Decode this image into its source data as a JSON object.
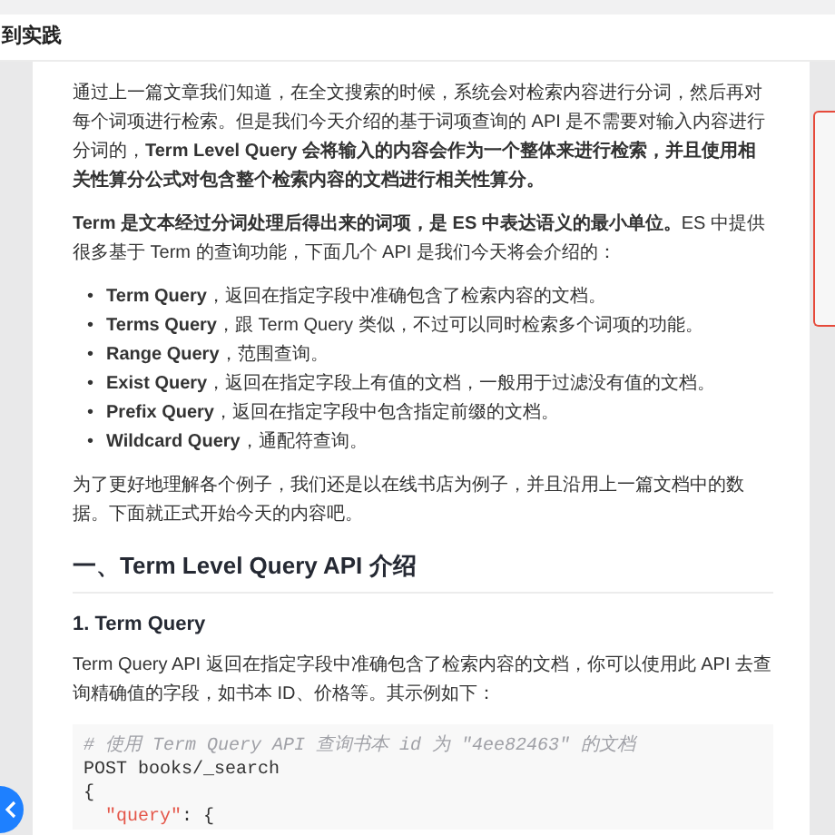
{
  "header": {
    "title": "到实践"
  },
  "paragraphs_top": [
    "通过上一篇文章我们知道，在全文搜索的时候，系统会对检索内容进行分词，然后再对每个词项进行检索。但是我们今天介绍的基于词项查询的 API 是不需要对输入内容进行分词的，**Term Level Query 会将输入的内容会作为一个整体来进行检索，并且使用相关性算分公式对包含整个检索内容的文档进行相关性算分。**",
    "**Term 是文本经过分词处理后得出来的词项，是 ES 中表达语义的最小单位。**ES 中提供很多基于 Term 的查询功能，下面几个 API 是我们今天将会介绍的："
  ],
  "query_list": [
    {
      "marker": "•",
      "text": "**Term Query**，返回在指定字段中准确包含了检索内容的文档。"
    },
    {
      "marker": "•",
      "text": "**Terms Query**，跟 Term Query 类似，不过可以同时检索多个词项的功能。"
    },
    {
      "marker": "•",
      "text": "**Range Query**，范围查询。"
    },
    {
      "marker": "•",
      "text": "**Exist Query**，返回在指定字段上有值的文档，一般用于过滤没有值的文档。"
    },
    {
      "marker": "•",
      "text": "**Prefix Query**，返回在指定字段中包含指定前缀的文档。"
    },
    {
      "marker": "•",
      "text": "**Wildcard Query**，通配符查询。"
    }
  ],
  "paragraph_examples": "为了更好地理解各个例子，我们还是以在线书店为例子，并且沿用上一篇文档中的数据。下面就正式开始今天的内容吧。",
  "section_heading": "一、Term Level Query API 介绍",
  "subsection_heading": "1. Term Query",
  "paragraph_term_query": "Term Query API 返回在指定字段中准确包含了检索内容的文档，你可以使用此 API 去查询精确值的字段，如书本 ID、价格等。其示例如下：",
  "code_lines": [
    {
      "indented": false,
      "tokens": [
        {
          "kind": "comment",
          "text": "# 使用 Term Query API 查询书本 id 为 \"4ee82463\" 的文档"
        }
      ]
    },
    {
      "indented": false,
      "tokens": [
        {
          "kind": "plain",
          "text": "POST books/_search"
        }
      ]
    },
    {
      "indented": false,
      "tokens": [
        {
          "kind": "plain",
          "text": "{"
        }
      ]
    },
    {
      "indented": true,
      "tokens": [
        {
          "kind": "key",
          "text": "\"query\""
        },
        {
          "kind": "plain",
          "text": ": {"
        }
      ]
    }
  ]
}
